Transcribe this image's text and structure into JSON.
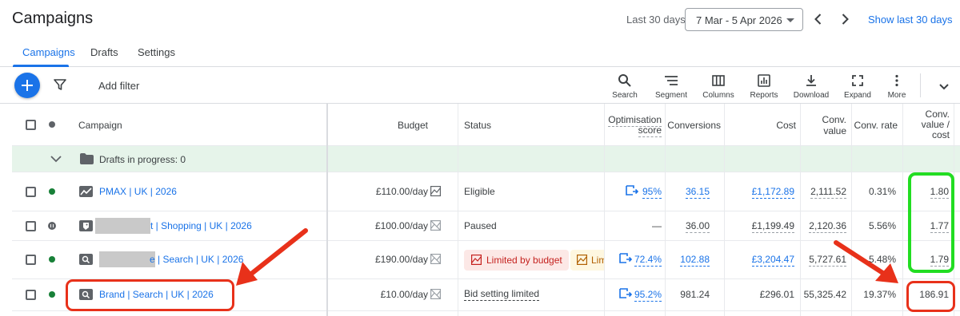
{
  "header": {
    "title": "Campaigns",
    "date_range_label": "Last 30 days",
    "date_range_value": "7 Mar - 5 Apr 2026",
    "show_last_link": "Show last 30 days"
  },
  "tabs": [
    {
      "label": "Campaigns",
      "active": true
    },
    {
      "label": "Drafts",
      "active": false
    },
    {
      "label": "Settings",
      "active": false
    }
  ],
  "toolbar": {
    "add_filter": "Add filter",
    "tools": [
      {
        "label": "Search",
        "icon": "search-icon"
      },
      {
        "label": "Segment",
        "icon": "segment-icon"
      },
      {
        "label": "Columns",
        "icon": "columns-icon"
      },
      {
        "label": "Reports",
        "icon": "reports-icon"
      },
      {
        "label": "Download",
        "icon": "download-icon"
      },
      {
        "label": "Expand",
        "icon": "expand-icon"
      },
      {
        "label": "More",
        "icon": "more-icon"
      }
    ]
  },
  "table": {
    "columns": {
      "campaign": "Campaign",
      "budget": "Budget",
      "status": "Status",
      "opt_score_1": "Optimisation",
      "opt_score_2": "score",
      "conversions": "Conversions",
      "cost": "Cost",
      "conv_value_1": "Conv.",
      "conv_value_2": "value",
      "conv_rate": "Conv. rate",
      "cvc_1": "Conv.",
      "cvc_2": "value /",
      "cvc_3": "cost"
    },
    "drafts_row": "Drafts in progress: 0",
    "rows": [
      {
        "name": "PMAX | UK | 2026",
        "budget": "£110.00/day",
        "status": "Eligible",
        "opt_score": "95%",
        "conversions": "36.15",
        "cost": "£1,172.89",
        "conv_value": "2,111.52",
        "conv_rate": "0.31%",
        "cvc": "1.80",
        "dot": "green",
        "type_icon": "pmax-icon"
      },
      {
        "name": "t | Shopping | UK | 2026",
        "budget": "£100.00/day",
        "status": "Paused",
        "opt_score": "—",
        "conversions": "36.00",
        "cost": "£1,199.49",
        "conv_value": "2,120.36",
        "conv_rate": "5.56%",
        "cvc": "1.77",
        "dot": "paused",
        "type_icon": "shopping-icon"
      },
      {
        "name": "e | Search | UK | 2026",
        "budget": "£190.00/day",
        "status_badge_red": "Limited by budget",
        "status_badge_yellow": "Lim",
        "opt_score": "72.4%",
        "conversions": "102.88",
        "cost": "£3,204.47",
        "conv_value": "5,727.61",
        "conv_rate": "5.48%",
        "cvc": "1.79",
        "dot": "green",
        "type_icon": "search-campaign-icon"
      },
      {
        "name": "Brand | Search | UK | 2026",
        "budget": "£10.00/day",
        "status": "Bid setting limited",
        "opt_score": "95.2%",
        "conversions": "981.24",
        "cost": "£296.01",
        "conv_value": "55,325.42",
        "conv_rate": "19.37%",
        "cvc": "186.91",
        "dot": "green",
        "type_icon": "search-campaign-icon"
      }
    ]
  },
  "annotations": {
    "highlight_green": "#22dd22",
    "highlight_red": "#e8311a"
  }
}
